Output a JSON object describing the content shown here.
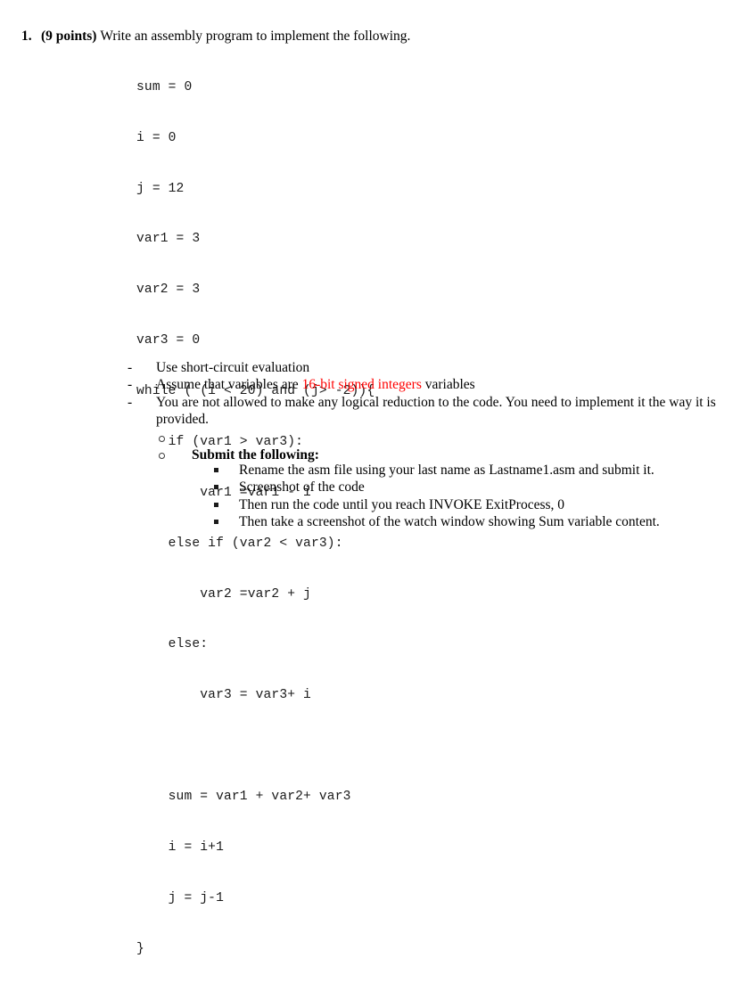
{
  "question": {
    "number": "1.",
    "points": "(9 points)",
    "prompt": "Write an assembly program to implement the following."
  },
  "code": {
    "lines": [
      "sum = 0",
      "i = 0",
      "j = 12",
      "var1 = 3",
      "var2 = 3",
      "var3 = 0",
      "while ( (i < 20) and (j> -2)){",
      "    if (var1 > var3):",
      "        var1 =var1 - i",
      "    else if (var2 < var3):",
      "        var2 =var2 + j",
      "    else:",
      "        var3 = var3+ i",
      "",
      "    sum = var1 + var2+ var3",
      "    i = i+1",
      "    j = j-1",
      "}"
    ]
  },
  "requirements": {
    "marker": "-",
    "items": [
      {
        "before": "Use short-circuit evaluation",
        "highlight": "",
        "after": ""
      },
      {
        "before": "Assume that variables are ",
        "highlight": "16-bit signed integers",
        "after": " variables"
      },
      {
        "before": "You are not allowed to make any logical reduction to the code. You need to implement it the way it is provided.",
        "highlight": "",
        "after": ""
      }
    ]
  },
  "submit_section": {
    "empty_bullet": "",
    "heading": "Submit the following:",
    "items": [
      "Rename the asm file using your last name as Lastname1.asm and submit it.",
      "Screenshot of the code",
      "Then run the code until you reach INVOKE ExitProcess, 0",
      "Then take a screenshot of the watch window showing Sum variable content."
    ]
  },
  "colors": {
    "page_background": "#ffffff",
    "body_text": "#000000",
    "code_text": "#1a1a1a",
    "highlight_red": "#ff0000"
  }
}
